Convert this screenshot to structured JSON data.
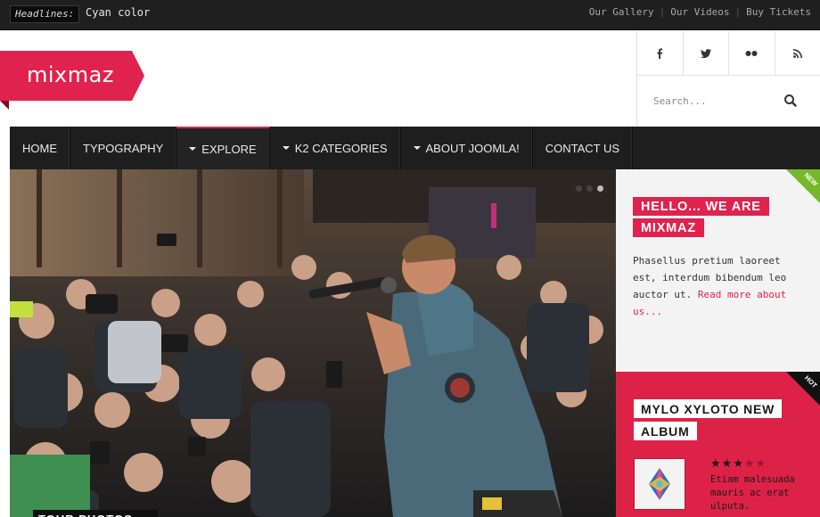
{
  "topbar": {
    "headlines_label": "Headlines:",
    "headline": "Cyan color",
    "links": [
      "Our Gallery",
      "Our Videos",
      "Buy Tickets"
    ],
    "separator": "|"
  },
  "header": {
    "logo_text": "mixmaz",
    "social_icons": [
      "facebook-icon",
      "twitter-icon",
      "flickr-icon",
      "rss-icon"
    ],
    "search_placeholder": "Search..."
  },
  "nav": {
    "items": [
      {
        "label": "HOME",
        "dropdown": false,
        "active": false
      },
      {
        "label": "TYPOGRAPHY",
        "dropdown": false,
        "active": false
      },
      {
        "label": "EXPLORE",
        "dropdown": true,
        "active": true
      },
      {
        "label": "K2 CATEGORIES",
        "dropdown": true,
        "active": false
      },
      {
        "label": "ABOUT JOOMLA!",
        "dropdown": true,
        "active": false
      },
      {
        "label": "CONTACT US",
        "dropdown": false,
        "active": false
      }
    ]
  },
  "slider": {
    "slide_count": 3,
    "active_slide": 3,
    "caption": "TOUR PHOTOS"
  },
  "promo": {
    "badge": "NEW",
    "title": "HELLO... WE ARE MIXMAZ",
    "body": "Phasellus pretium laoreet est, interdum bibendum leo auctor ut.",
    "more_link": "Read more about us..."
  },
  "album": {
    "badge": "HOT",
    "title": "MYLO XYLOTO NEW ALBUM",
    "rating": 3,
    "rating_max": 5,
    "body": "Etiam malesuada mauris ac erat ulputa."
  },
  "colors": {
    "accent": "#e0224e",
    "topbar": "#1f1f1f",
    "nav": "#1e1e1e",
    "new_badge": "#76b82a",
    "hot_badge": "#111111"
  }
}
